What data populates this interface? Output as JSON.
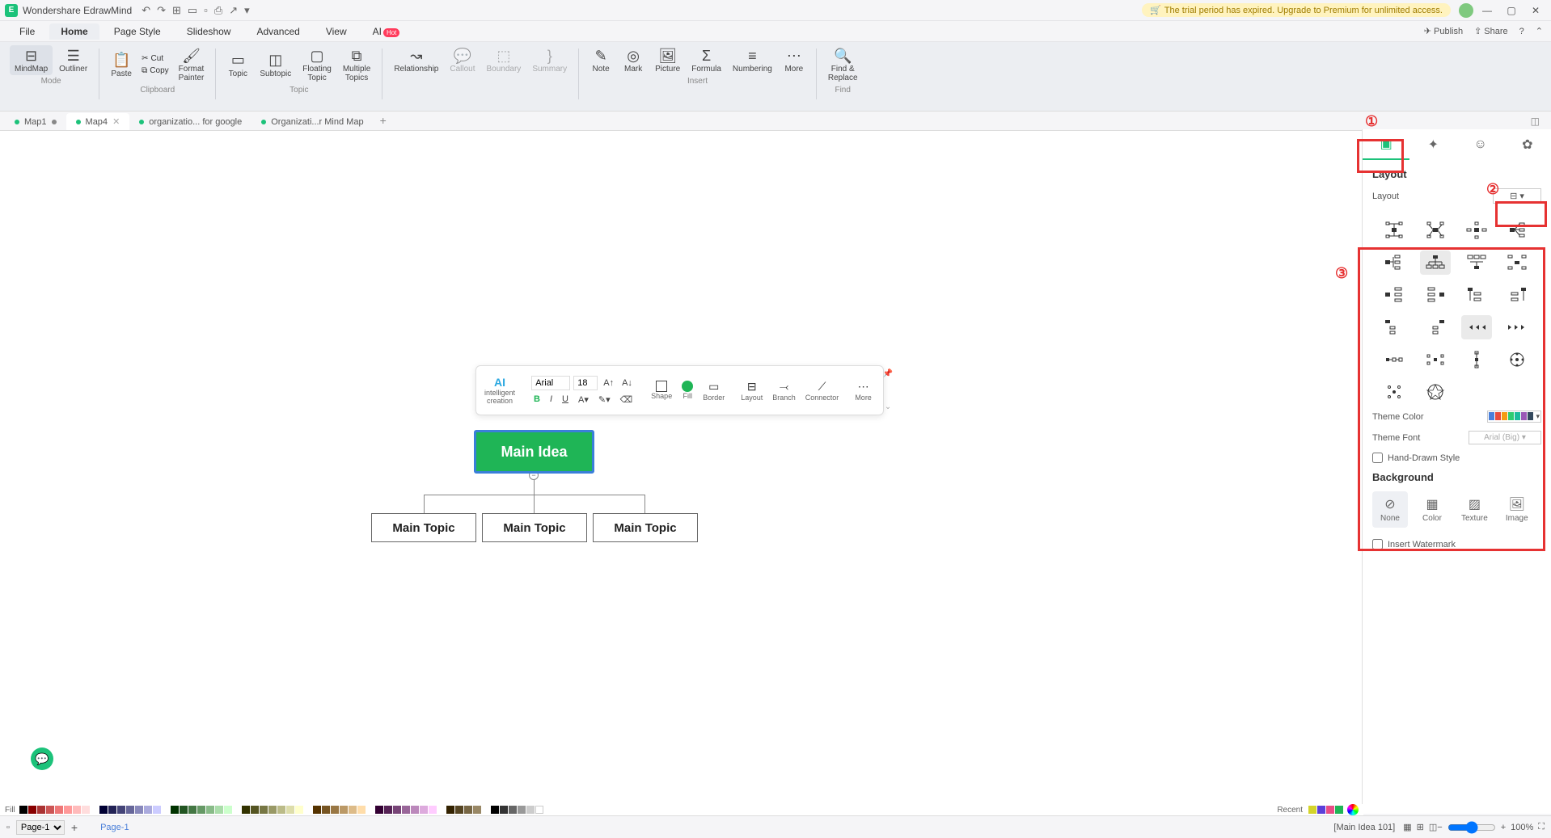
{
  "app": {
    "title": "Wondershare EdrawMind",
    "trial_banner": "The trial period has expired. Upgrade to Premium for unlimited access."
  },
  "menu": {
    "items": [
      "File",
      "Home",
      "Page Style",
      "Slideshow",
      "Advanced",
      "View",
      "AI"
    ],
    "active": "Home",
    "right": {
      "publish": "Publish",
      "share": "Share"
    }
  },
  "ribbon": {
    "mode": {
      "mindmap": "MindMap",
      "outliner": "Outliner",
      "label": "Mode"
    },
    "clipboard": {
      "paste": "Paste",
      "cut": "Cut",
      "copy": "Copy",
      "format_painter": "Format\nPainter",
      "label": "Clipboard"
    },
    "topic": {
      "topic": "Topic",
      "subtopic": "Subtopic",
      "floating": "Floating\nTopic",
      "multiple": "Multiple\nTopics",
      "label": "Topic"
    },
    "items": {
      "relationship": "Relationship",
      "callout": "Callout",
      "boundary": "Boundary",
      "summary": "Summary"
    },
    "insert": {
      "note": "Note",
      "mark": "Mark",
      "picture": "Picture",
      "formula": "Formula",
      "numbering": "Numbering",
      "more": "More",
      "label": "Insert"
    },
    "find": {
      "label": "Find &\nReplace",
      "sublabel": "Find"
    }
  },
  "tabs": [
    {
      "name": "Map1",
      "active": false,
      "dirty": true
    },
    {
      "name": "Map4",
      "active": true,
      "dirty": false
    },
    {
      "name": "organizatio... for google",
      "active": false,
      "dirty": false
    },
    {
      "name": "Organizati...r Mind Map",
      "active": false,
      "dirty": false
    }
  ],
  "mindmap": {
    "main": "Main Idea",
    "topics": [
      "Main Topic",
      "Main Topic",
      "Main Topic"
    ]
  },
  "float_toolbar": {
    "ai": "AI",
    "ai_label": "intelligent\ncreation",
    "font": "Arial",
    "size": "18",
    "shape": "Shape",
    "fill": "Fill",
    "border": "Border",
    "layout": "Layout",
    "branch": "Branch",
    "connector": "Connector",
    "more": "More"
  },
  "rightpanel": {
    "layout_header": "Layout",
    "layout_label": "Layout",
    "theme_color": "Theme Color",
    "theme_font": "Theme Font",
    "theme_font_value": "Arial (Big)",
    "hand_drawn": "Hand-Drawn Style",
    "background": "Background",
    "bg_none": "None",
    "bg_color": "Color",
    "bg_texture": "Texture",
    "bg_image": "Image",
    "watermark": "Insert Watermark"
  },
  "annotations": {
    "n1": "①",
    "n2": "②",
    "n3": "③"
  },
  "status": {
    "page_select": "Page-1",
    "page_current": "Page-1",
    "node_info": "[Main Idea 101]",
    "zoom": "100%",
    "fill_label": "Fill",
    "recent_label": "Recent"
  }
}
